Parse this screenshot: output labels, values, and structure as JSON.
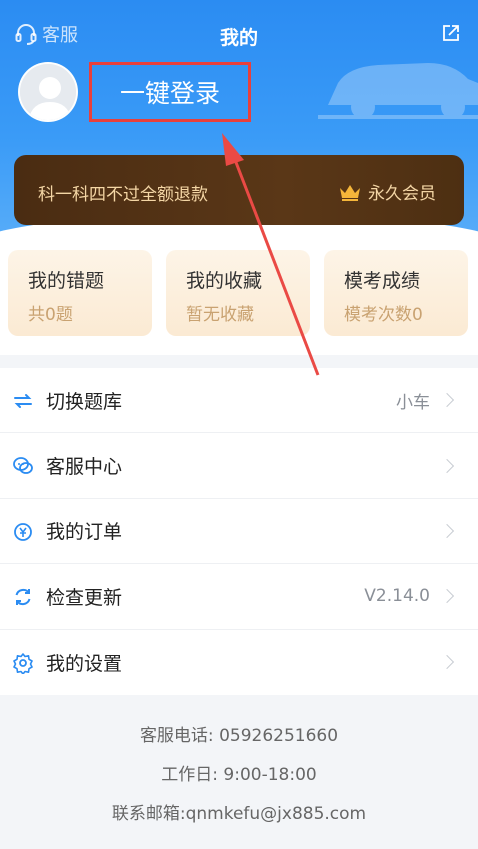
{
  "header": {
    "service_label": "客服",
    "title": "我的",
    "login_label": "一键登录"
  },
  "vip": {
    "promo": "科一科四不过全额退款",
    "badge": "永久会员"
  },
  "stats": [
    {
      "title": "我的错题",
      "sub": "共0题"
    },
    {
      "title": "我的收藏",
      "sub": "暂无收藏"
    },
    {
      "title": "模考成绩",
      "sub": "模考次数0"
    }
  ],
  "menu": [
    {
      "label": "切换题库",
      "value": "小车",
      "icon": "switch-icon"
    },
    {
      "label": "客服中心",
      "value": "",
      "icon": "chat-icon"
    },
    {
      "label": "我的订单",
      "value": "",
      "icon": "order-icon"
    },
    {
      "label": "检查更新",
      "value": "V2.14.0",
      "icon": "refresh-icon"
    },
    {
      "label": "我的设置",
      "value": "",
      "icon": "gear-icon"
    }
  ],
  "footer": {
    "phone": "客服电话: 05926251660",
    "hours": "工作日:  9:00-18:00",
    "email": "联系邮箱:qnmkefu@jx885.com"
  },
  "colors": {
    "header_blue": "#2b8cf2",
    "vip_brown": "#4a2c12",
    "vip_gold": "#f4d6a5",
    "highlight_red": "#e8403c",
    "stat_sub": "#c9a271"
  }
}
